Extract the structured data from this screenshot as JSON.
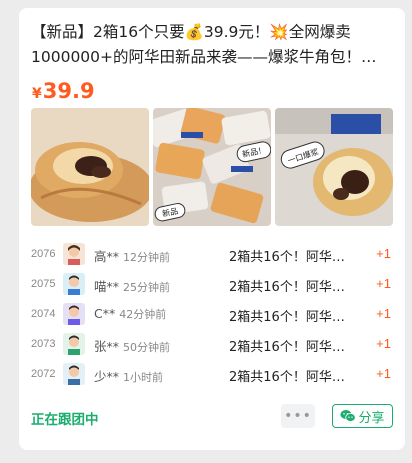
{
  "post": {
    "title": "【新品】2箱16个只要💰39.9元！💥全网爆卖1000000+的阿华田新品来袭——爆浆牛角包！✅ …",
    "price_symbol": "¥",
    "price_value": "39.9",
    "image_labels": [
      "新品！",
      "新品",
      "一口爆浆"
    ]
  },
  "orders": [
    {
      "num": "2076",
      "name": "高**",
      "time": "12分钟前",
      "item": "2箱共16个！阿华…",
      "count": "+1"
    },
    {
      "num": "2075",
      "name": "喵**",
      "time": "25分钟前",
      "item": "2箱共16个！阿华…",
      "count": "+1"
    },
    {
      "num": "2074",
      "name": "C**",
      "time": "42分钟前",
      "item": "2箱共16个！阿华…",
      "count": "+1"
    },
    {
      "num": "2073",
      "name": "张**",
      "time": "50分钟前",
      "item": "2箱共16个！阿华…",
      "count": "+1"
    },
    {
      "num": "2072",
      "name": "少**",
      "time": "1小时前",
      "item": "2箱共16个！阿华…",
      "count": "+1"
    }
  ],
  "footer": {
    "status": "正在跟团中",
    "more_label": "•••",
    "share_label": "分享"
  },
  "colors": {
    "accent": "#ff5a1f",
    "green": "#1aad6e"
  },
  "icons": [
    "money-bag-icon",
    "explosion-icon",
    "check-icon",
    "more-icon",
    "wechat-icon"
  ]
}
